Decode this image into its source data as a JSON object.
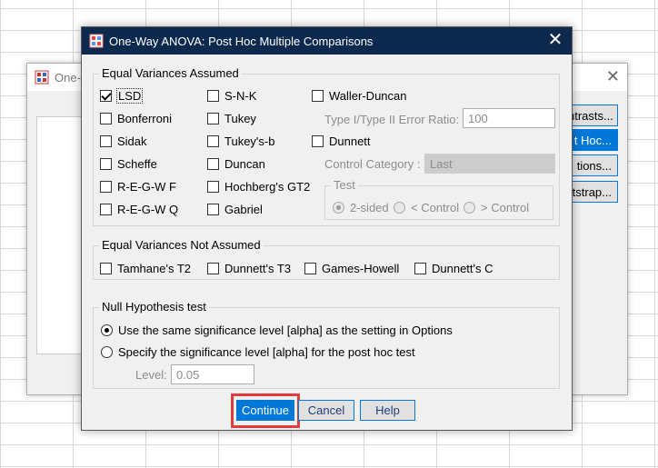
{
  "background_dialog": {
    "title": "One-W",
    "buttons": [
      "ntrasts...",
      "t Hoc...",
      "tions...",
      "tstrap..."
    ]
  },
  "dialog": {
    "title": "One-Way ANOVA: Post Hoc Multiple Comparisons",
    "close_glyph": "✕"
  },
  "equal_variances": {
    "title": "Equal Variances Assumed",
    "col1": [
      {
        "label": "LSD",
        "checked": true
      },
      {
        "label": "Bonferroni",
        "checked": false
      },
      {
        "label": "Sidak",
        "checked": false
      },
      {
        "label": "Scheffe",
        "checked": false
      },
      {
        "label": "R-E-G-W F",
        "checked": false
      },
      {
        "label": "R-E-G-W Q",
        "checked": false
      }
    ],
    "col2": [
      {
        "label": "S-N-K",
        "checked": false
      },
      {
        "label": "Tukey",
        "checked": false
      },
      {
        "label": "Tukey's-b",
        "checked": false
      },
      {
        "label": "Duncan",
        "checked": false
      },
      {
        "label": "Hochberg's GT2",
        "checked": false
      },
      {
        "label": "Gabriel",
        "checked": false
      }
    ],
    "waller_duncan": "Waller-Duncan",
    "error_ratio_label": "Type I/Type II Error Ratio:",
    "error_ratio_value": "100",
    "dunnett": "Dunnett",
    "control_category_label": "Control Category :",
    "control_category_value": "Last",
    "test": {
      "title": "Test",
      "options": [
        "2-sided",
        "< Control",
        "> Control"
      ],
      "selected": "2-sided"
    }
  },
  "equal_variances_not_assumed": {
    "title": "Equal Variances Not Assumed",
    "options": [
      "Tamhane's T2",
      "Dunnett's T3",
      "Games-Howell",
      "Dunnett's C"
    ]
  },
  "null_hypothesis": {
    "title": "Null Hypothesis test",
    "option1": "Use the same significance level [alpha] as the setting in Options",
    "option2": "Specify the significance level [alpha] for the post hoc test",
    "level_label": "Level:",
    "level_value": "0.05"
  },
  "buttons": {
    "continue": "Continue",
    "cancel": "Cancel",
    "help": "Help"
  },
  "colors": {
    "titlebar": "#0d294e",
    "accent": "#0078d7",
    "highlight": "#e03a3a"
  }
}
